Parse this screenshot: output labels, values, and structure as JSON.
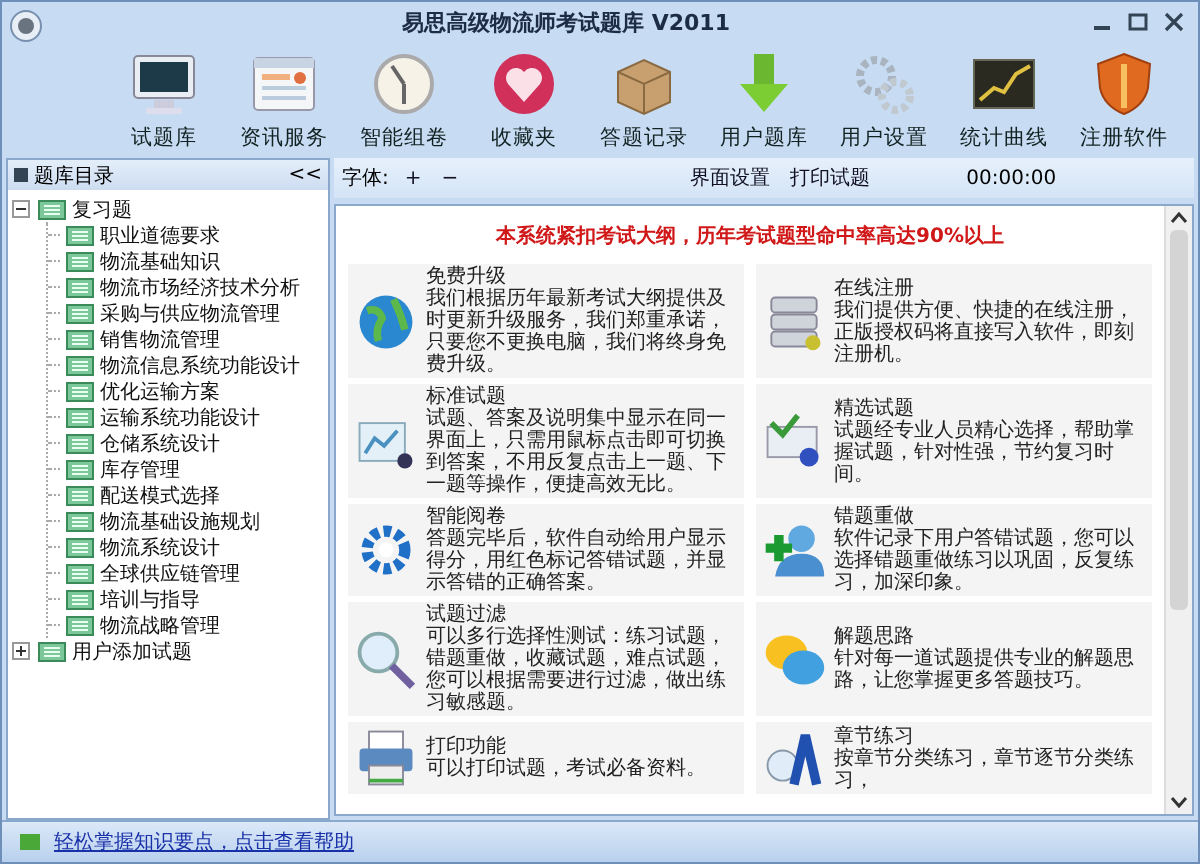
{
  "window": {
    "title": "易思高级物流师考试题库 V2011"
  },
  "toolbar": [
    {
      "label": "试题库"
    },
    {
      "label": "资讯服务"
    },
    {
      "label": "智能组卷"
    },
    {
      "label": "收藏夹"
    },
    {
      "label": "答题记录"
    },
    {
      "label": "用户题库"
    },
    {
      "label": "用户设置"
    },
    {
      "label": "统计曲线"
    },
    {
      "label": "注册软件"
    }
  ],
  "sidebar": {
    "title": "题库目录",
    "collapse": "<<",
    "tree": [
      {
        "label": "复习题",
        "expanded": true,
        "children": [
          {
            "label": "职业道德要求"
          },
          {
            "label": "物流基础知识"
          },
          {
            "label": "物流市场经济技术分析"
          },
          {
            "label": "采购与供应物流管理"
          },
          {
            "label": "销售物流管理"
          },
          {
            "label": "物流信息系统功能设计"
          },
          {
            "label": "优化运输方案"
          },
          {
            "label": "运输系统功能设计"
          },
          {
            "label": "仓储系统设计"
          },
          {
            "label": "库存管理"
          },
          {
            "label": "配送模式选择"
          },
          {
            "label": "物流基础设施规划"
          },
          {
            "label": "物流系统设计"
          },
          {
            "label": "全球供应链管理"
          },
          {
            "label": "培训与指导"
          },
          {
            "label": "物流战略管理"
          }
        ]
      },
      {
        "label": "用户添加试题",
        "expanded": false
      }
    ]
  },
  "content_toolbar": {
    "font_label": "字体:",
    "font_plus": "+",
    "font_minus": "−",
    "buttons": [
      "界面设置",
      "打印试题"
    ],
    "timer": "00:00:00"
  },
  "banner": "本系统紧扣考试大纲，历年考试题型命中率高达90%以上",
  "features": [
    {
      "title": "免费升级",
      "text": "我们根据历年最新考试大纲提供及时更新升级服务，我们郑重承诺，只要您不更换电脑，我们将终身免费升级。"
    },
    {
      "title": "在线注册",
      "text": "我们提供方便、快捷的在线注册，正版授权码将直接写入软件，即刻注册机。"
    },
    {
      "title": "标准试题",
      "text": "试题、答案及说明集中显示在同一界面上，只需用鼠标点击即可切换到答案，不用反复点击上一题、下一题等操作，便捷高效无比。"
    },
    {
      "title": "精选试题",
      "text": "试题经专业人员精心选择，帮助掌握试题，针对性强，节约复习时间。"
    },
    {
      "title": "智能阅卷",
      "text": "答题完毕后，软件自动给用户显示得分，用红色标记答错试题，并显示答错的正确答案。"
    },
    {
      "title": "错题重做",
      "text": "软件记录下用户答错试题，您可以选择错题重做练习以巩固，反复练习，加深印象。"
    },
    {
      "title": "试题过滤",
      "text": "可以多行选择性测试：练习试题，错题重做，收藏试题，难点试题，您可以根据需要进行过滤，做出练习敏感题。"
    },
    {
      "title": "解题思路",
      "text": "针对每一道试题提供专业的解题思路，让您掌握更多答题技巧。"
    },
    {
      "title": "打印功能",
      "text": "可以打印试题，考试必备资料。"
    },
    {
      "title": "章节练习",
      "text": "按章节分类练习，章节逐节分类练习，"
    }
  ],
  "status_bar": {
    "text": "轻松掌握知识要点，点击查看帮助"
  }
}
